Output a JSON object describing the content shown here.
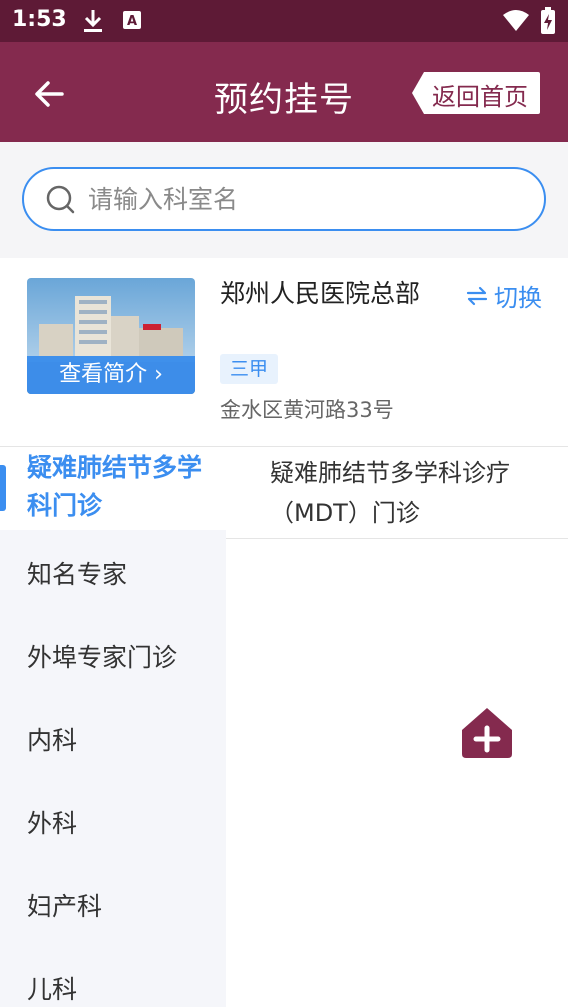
{
  "status": {
    "time": "1:53",
    "icons": [
      "download-icon",
      "a-notification-icon",
      "wifi-icon",
      "battery-charging-icon"
    ]
  },
  "header": {
    "title": "预约挂号",
    "home_label": "返回首页"
  },
  "search": {
    "placeholder": "请输入科室名"
  },
  "hospital": {
    "name": "郑州人民医院总部",
    "level": "三甲",
    "address": "金水区黄河路33号",
    "intro_label": "查看简介 ›",
    "switch_label": "切换"
  },
  "sidebar": {
    "items": [
      {
        "label": "疑难肺结节多学科门诊",
        "active": true
      },
      {
        "label": "知名专家"
      },
      {
        "label": "外埠专家门诊"
      },
      {
        "label": "内科"
      },
      {
        "label": "外科"
      },
      {
        "label": "妇产科"
      },
      {
        "label": "儿科"
      }
    ]
  },
  "departments": [
    {
      "label": "疑难肺结节多学科诊疗（MDT）门诊"
    }
  ],
  "colors": {
    "brand": "#842a4e",
    "status_bar": "#5e1a36",
    "accent": "#3b8ef0"
  }
}
